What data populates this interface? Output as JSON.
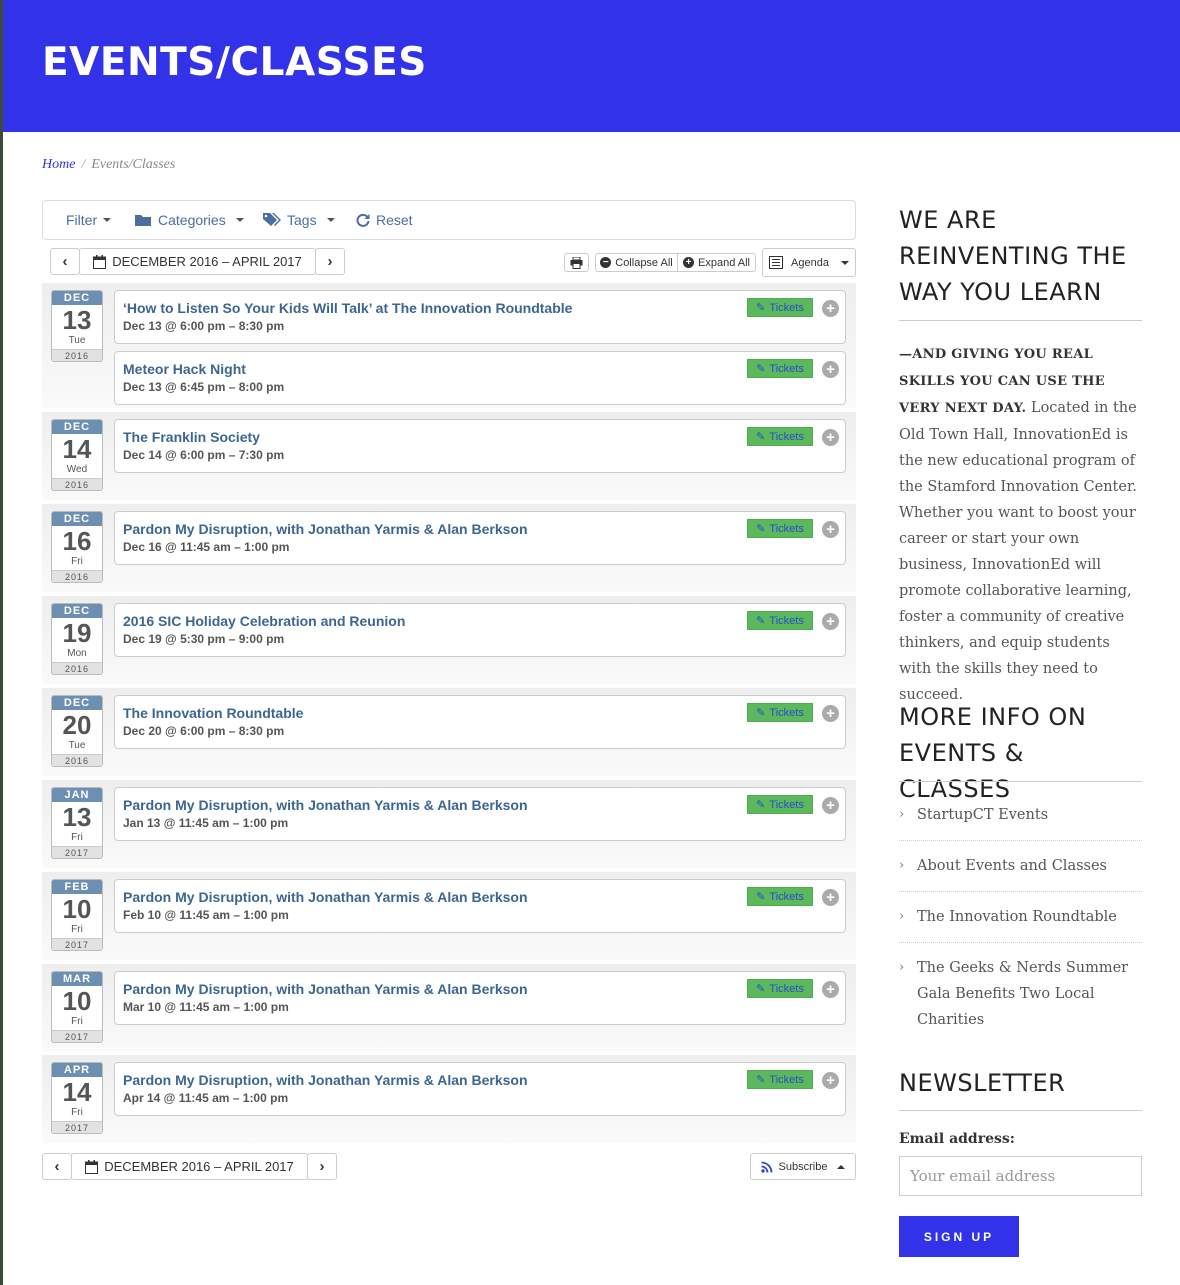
{
  "header": {
    "title": "EVENTS/CLASSES"
  },
  "breadcrumb": {
    "home": "Home",
    "sep": "/",
    "current": "Events/Classes"
  },
  "filters": {
    "filter": "Filter",
    "categories": "Categories",
    "tags": "Tags",
    "reset": "Reset"
  },
  "toolbar": {
    "date_range": "DECEMBER 2016 – APRIL 2017",
    "collapse": "Collapse All",
    "expand": "Expand All",
    "view": "Agenda",
    "subscribe": "Subscribe"
  },
  "days": [
    {
      "mon": "DEC",
      "day": "13",
      "wd": "Tue",
      "yr": "2016",
      "events": [
        {
          "title": "‘How to Listen So Your Kids Will Talk’ at The Innovation Roundtable",
          "time": "Dec 13 @ 6:00 pm – 8:30 pm",
          "tickets": "Tickets"
        },
        {
          "title": "Meteor Hack Night",
          "time": "Dec 13 @ 6:45 pm – 8:00 pm",
          "tickets": "Tickets"
        }
      ]
    },
    {
      "mon": "DEC",
      "day": "14",
      "wd": "Wed",
      "yr": "2016",
      "events": [
        {
          "title": "The Franklin Society",
          "time": "Dec 14 @ 6:00 pm – 7:30 pm",
          "tickets": "Tickets"
        }
      ]
    },
    {
      "mon": "DEC",
      "day": "16",
      "wd": "Fri",
      "yr": "2016",
      "events": [
        {
          "title": "Pardon My Disruption, with Jonathan Yarmis & Alan Berkson",
          "time": "Dec 16 @ 11:45 am – 1:00 pm",
          "tickets": "Tickets"
        }
      ]
    },
    {
      "mon": "DEC",
      "day": "19",
      "wd": "Mon",
      "yr": "2016",
      "events": [
        {
          "title": "2016 SIC Holiday Celebration and Reunion",
          "time": "Dec 19 @ 5:30 pm – 9:00 pm",
          "tickets": "Tickets"
        }
      ]
    },
    {
      "mon": "DEC",
      "day": "20",
      "wd": "Tue",
      "yr": "2016",
      "events": [
        {
          "title": "The Innovation Roundtable",
          "time": "Dec 20 @ 6:00 pm – 8:30 pm",
          "tickets": "Tickets"
        }
      ]
    },
    {
      "mon": "JAN",
      "day": "13",
      "wd": "Fri",
      "yr": "2017",
      "events": [
        {
          "title": "Pardon My Disruption, with Jonathan Yarmis & Alan Berkson",
          "time": "Jan 13 @ 11:45 am – 1:00 pm",
          "tickets": "Tickets"
        }
      ]
    },
    {
      "mon": "FEB",
      "day": "10",
      "wd": "Fri",
      "yr": "2017",
      "events": [
        {
          "title": "Pardon My Disruption, with Jonathan Yarmis & Alan Berkson",
          "time": "Feb 10 @ 11:45 am – 1:00 pm",
          "tickets": "Tickets"
        }
      ]
    },
    {
      "mon": "MAR",
      "day": "10",
      "wd": "Fri",
      "yr": "2017",
      "events": [
        {
          "title": "Pardon My Disruption, with Jonathan Yarmis & Alan Berkson",
          "time": "Mar 10 @ 11:45 am – 1:00 pm",
          "tickets": "Tickets"
        }
      ]
    },
    {
      "mon": "APR",
      "day": "14",
      "wd": "Fri",
      "yr": "2017",
      "events": [
        {
          "title": "Pardon My Disruption, with Jonathan Yarmis & Alan Berkson",
          "time": "Apr 14 @ 11:45 am – 1:00 pm",
          "tickets": "Tickets"
        }
      ]
    }
  ],
  "sidebar": {
    "heading1": "WE ARE REINVENTING THE WAY YOU LEARN",
    "lead": "—AND GIVING YOU REAL SKILLS YOU CAN USE THE VERY NEXT DAY.",
    "body": " Located in the Old Town Hall, InnovationEd is the new educational program of the Stamford Innovation Center. Whether you want to boost your career or start your own business, InnovationEd will promote collaborative learning, foster a community of creative thinkers, and equip students with the skills they need to succeed.",
    "heading2": "MORE INFO ON EVENTS & CLASSES",
    "links": [
      "StartupCT Events",
      "About Events and Classes",
      "The Innovation Roundtable",
      "The Geeks & Nerds Summer Gala Benefits Two Local Charities"
    ],
    "heading3": "NEWSLETTER",
    "email_label": "Email address:",
    "email_placeholder": "Your email address",
    "signup": "SIGN UP"
  },
  "colors": {
    "brand": "#3232e8",
    "tickets": "#5cb85c",
    "link": "#3c6690"
  }
}
